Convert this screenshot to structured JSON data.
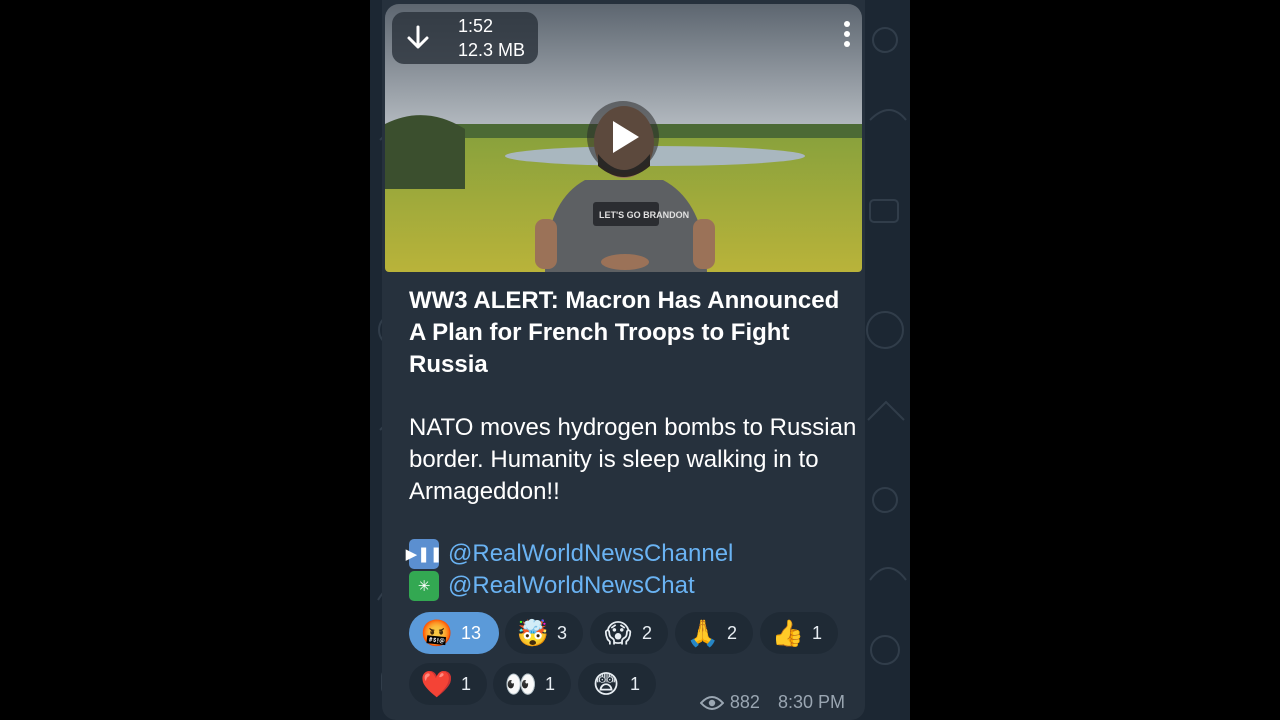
{
  "video": {
    "duration": "1:52",
    "size": "12.3 MB",
    "shirt_text": "LET'S GO BRANDON"
  },
  "post": {
    "title": "WW3 ALERT: Macron Has Announced A  Plan for French Troops to Fight Russia",
    "body": "NATO moves hydrogen bombs to Russian border. Humanity is sleep walking in to Armageddon!!"
  },
  "links": [
    {
      "icon": "play-pause-icon",
      "text": "@RealWorldNewsChannel",
      "color": "#6ab3f3"
    },
    {
      "icon": "eight-spoked-asterisk-icon",
      "text": "@RealWorldNewsChat",
      "color": "#6ab3f3"
    }
  ],
  "reactions": [
    {
      "emoji": "🤬",
      "count": "13",
      "active": true
    },
    {
      "emoji": "🤯",
      "count": "3"
    },
    {
      "emoji": "😱",
      "count": "2"
    },
    {
      "emoji": "🙏",
      "count": "2"
    },
    {
      "emoji": "👍",
      "count": "1"
    },
    {
      "emoji": "❤️",
      "count": "1"
    },
    {
      "emoji": "👀",
      "count": "1"
    },
    {
      "emoji": "😨",
      "count": "1"
    }
  ],
  "meta": {
    "views": "882",
    "time": "8:30 PM"
  },
  "colors": {
    "bubble": "#26313d",
    "background": "#1c2733",
    "link": "#6ab3f3",
    "active_reaction": "#5b9ad9"
  }
}
